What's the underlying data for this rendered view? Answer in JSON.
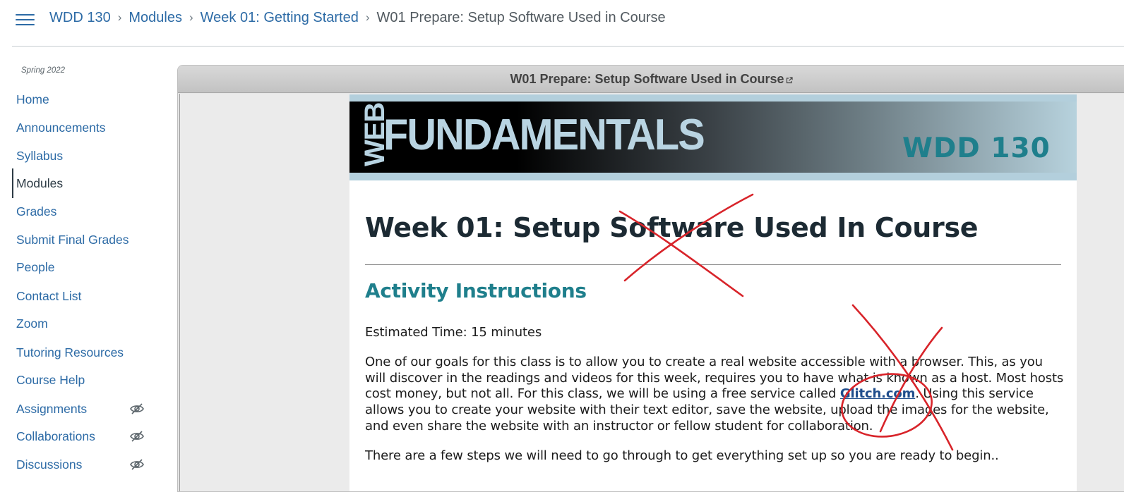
{
  "breadcrumb": {
    "items": [
      "WDD 130",
      "Modules",
      "Week 01: Getting Started"
    ],
    "current": "W01 Prepare: Setup Software Used in Course",
    "separator": "›"
  },
  "sidebar": {
    "term": "Spring 2022",
    "items": [
      {
        "label": "Home"
      },
      {
        "label": "Announcements"
      },
      {
        "label": "Syllabus"
      },
      {
        "label": "Modules",
        "active": true
      },
      {
        "label": "Grades"
      },
      {
        "label": "Submit Final Grades"
      },
      {
        "label": "People"
      },
      {
        "label": "Contact List"
      },
      {
        "label": "Zoom"
      },
      {
        "label": "Tutoring Resources"
      },
      {
        "label": "Course Help"
      },
      {
        "label": "Assignments",
        "hidden_icon": "eye-slash-icon"
      },
      {
        "label": "Collaborations",
        "hidden_icon": "eye-slash-icon"
      },
      {
        "label": "Discussions",
        "hidden_icon": "eye-slash-icon"
      }
    ]
  },
  "frame": {
    "title": "W01 Prepare: Setup Software Used in Course",
    "title_icon": "external-link-icon"
  },
  "banner": {
    "web": "WEB",
    "title": "FUNDAMENTALS",
    "course_code": "WDD 130"
  },
  "content": {
    "heading": "Week 01: Setup Software Used In Course",
    "subheading": "Activity Instructions",
    "estimated_time": "Estimated Time: 15 minutes",
    "para1_before": "One of our goals for this class is to allow you to create a real website accessible with a browser.  This, as you will discover in the readings and videos for this week, requires you to have what is known as a host.  Most hosts cost money, but not all.  For this class, we will be using a free service called ",
    "para1_link": "Glitch.com",
    "para1_after": ". Using this service allows you to create your website with their text editor, save the website, upload the images for the website, and even share the website with an instructor or fellow student for collaboration.",
    "para2": "There are a few steps we will need to go through to get everything set up so you are ready to begin.."
  },
  "colors": {
    "link": "#2d6ba6",
    "accent_teal": "#1f7f8c",
    "annotation": "#d8242a"
  }
}
